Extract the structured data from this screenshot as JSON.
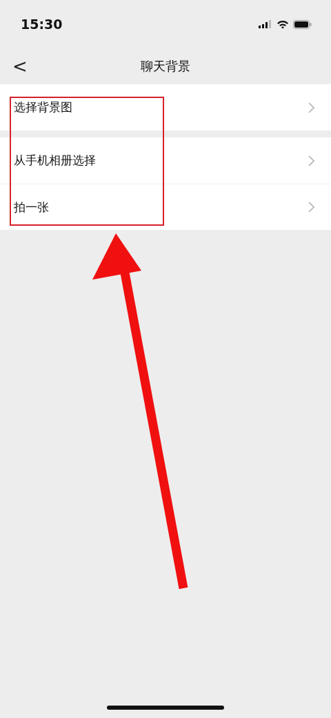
{
  "status_bar": {
    "time": "15:30"
  },
  "nav_bar": {
    "back": "<",
    "title": "聊天背景"
  },
  "groups": [
    {
      "items": [
        {
          "label": "选择背景图"
        }
      ]
    },
    {
      "items": [
        {
          "label": "从手机相册选择"
        },
        {
          "label": "拍一张"
        }
      ]
    }
  ]
}
